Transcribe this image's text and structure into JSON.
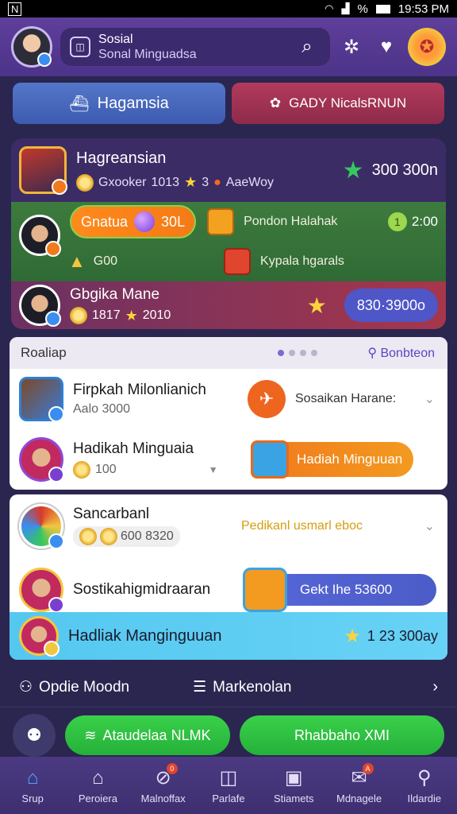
{
  "status_bar": {
    "time": "19:53 PM",
    "battery_text": "%"
  },
  "header": {
    "search_line1": "Sosial",
    "search_line2": "Sonal Minguadsa"
  },
  "tabs": [
    {
      "label": "Hagamsia"
    },
    {
      "label": "GADY NicalsRNUN"
    }
  ],
  "panel1": {
    "top": {
      "name": "Hagreansian",
      "sub_a": "Gxooker",
      "sub_b": "1013",
      "sub_c": "3",
      "sub_d": "AaeWoy",
      "right_value": "300 300n"
    },
    "green": {
      "pill_label": "Gnatua",
      "pill_value": "30L",
      "coins": "G00",
      "item1": "Pondon Halahak",
      "timer": "2:00",
      "timer_icon": "1",
      "item2": "Kypala hgarals"
    },
    "red": {
      "name": "Gbgika Mane",
      "sub_a": "1817",
      "sub_b": "2010",
      "score": "830·3900o"
    }
  },
  "panel2": {
    "header_left": "Roaliap",
    "header_right": "Bonbteon",
    "rows": [
      {
        "name": "Firpkah Milonlianich",
        "sub": "Aalo 3000",
        "right_text": "Sosaikan Harane:"
      },
      {
        "name": "Hadikah Minguaia",
        "sub": "100",
        "button": "Hadiah Minguuan"
      }
    ]
  },
  "panel3": {
    "rows": [
      {
        "name": "Sancarbanl",
        "coins": "600 8320",
        "right_text": "Pedikanl usmarl eboc"
      },
      {
        "name": "Sostikahigmidraaran",
        "pill_text": "Gekt Ihe 53600"
      }
    ],
    "highlight": {
      "name": "Hadliak Manginguuan",
      "value": "1 23 300ay"
    }
  },
  "ops": {
    "left": "Opdie Moodn",
    "right": "Markenolan"
  },
  "cta": {
    "btn_a": "Ataudelaa NLMK",
    "btn_b": "Rhabbaho XMI"
  },
  "nav": [
    {
      "label": "Srup",
      "icon": "home-icon"
    },
    {
      "label": "Peroiera",
      "icon": "house-icon"
    },
    {
      "label": "Malnoffax",
      "icon": "rocket-icon",
      "badge": "0"
    },
    {
      "label": "Parlafe",
      "icon": "window-icon"
    },
    {
      "label": "Stiamets",
      "icon": "chat-box-icon"
    },
    {
      "label": "Mdnagele",
      "icon": "speech-bubble-icon",
      "badge": "A"
    },
    {
      "label": "Ildardie",
      "icon": "user-icon"
    }
  ]
}
